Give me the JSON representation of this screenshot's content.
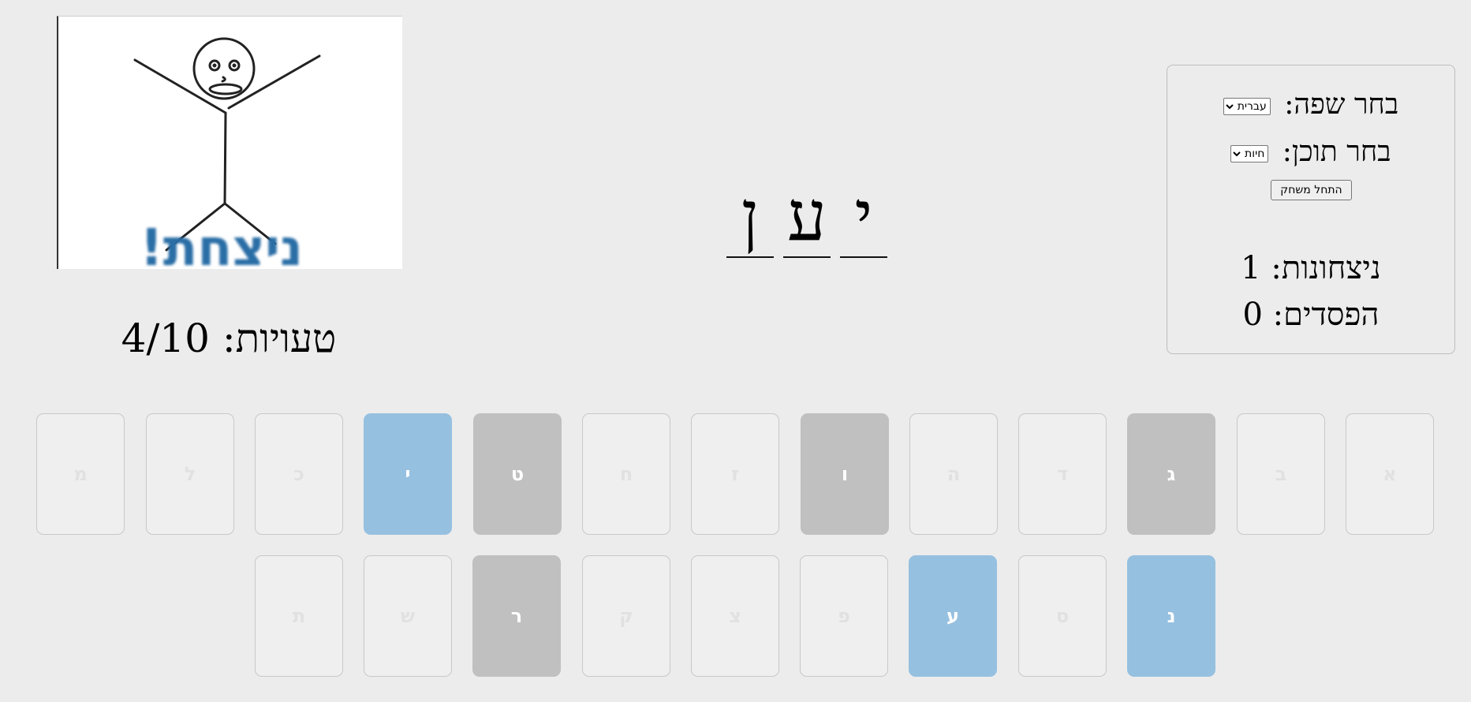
{
  "hangman": {
    "image": "stick-figure-arms-raised",
    "win_text": "ניצחת!"
  },
  "mistakes_text": "טעויות: 4/10",
  "word": {
    "slots": [
      "י",
      "ע",
      "ן"
    ]
  },
  "settings": {
    "language_label": "בחר שפה:",
    "language_value": "עברית",
    "content_label": "בחר תוכן:",
    "content_value": "חיות",
    "start_label": "התחל משחק",
    "wins_text": "ניצחונות: 1",
    "losses_text": "הפסדים: 0"
  },
  "colors": {
    "correct": "#96c0e0",
    "wrong": "#c0c0c0",
    "unused": "#efefef"
  },
  "keyboard": {
    "row1": [
      {
        "letter": "א",
        "state": "unused"
      },
      {
        "letter": "ב",
        "state": "unused"
      },
      {
        "letter": "ג",
        "state": "wrong"
      },
      {
        "letter": "ד",
        "state": "unused"
      },
      {
        "letter": "ה",
        "state": "unused"
      },
      {
        "letter": "ו",
        "state": "wrong"
      },
      {
        "letter": "ז",
        "state": "unused"
      },
      {
        "letter": "ח",
        "state": "unused"
      },
      {
        "letter": "ט",
        "state": "wrong"
      },
      {
        "letter": "י",
        "state": "correct"
      },
      {
        "letter": "כ",
        "state": "unused"
      },
      {
        "letter": "ל",
        "state": "unused"
      },
      {
        "letter": "מ",
        "state": "unused"
      }
    ],
    "row2": [
      {
        "letter": "נ",
        "state": "correct"
      },
      {
        "letter": "ס",
        "state": "unused"
      },
      {
        "letter": "ע",
        "state": "correct"
      },
      {
        "letter": "פ",
        "state": "unused"
      },
      {
        "letter": "צ",
        "state": "unused"
      },
      {
        "letter": "ק",
        "state": "unused"
      },
      {
        "letter": "ר",
        "state": "wrong"
      },
      {
        "letter": "ש",
        "state": "unused"
      },
      {
        "letter": "ת",
        "state": "unused"
      }
    ]
  }
}
